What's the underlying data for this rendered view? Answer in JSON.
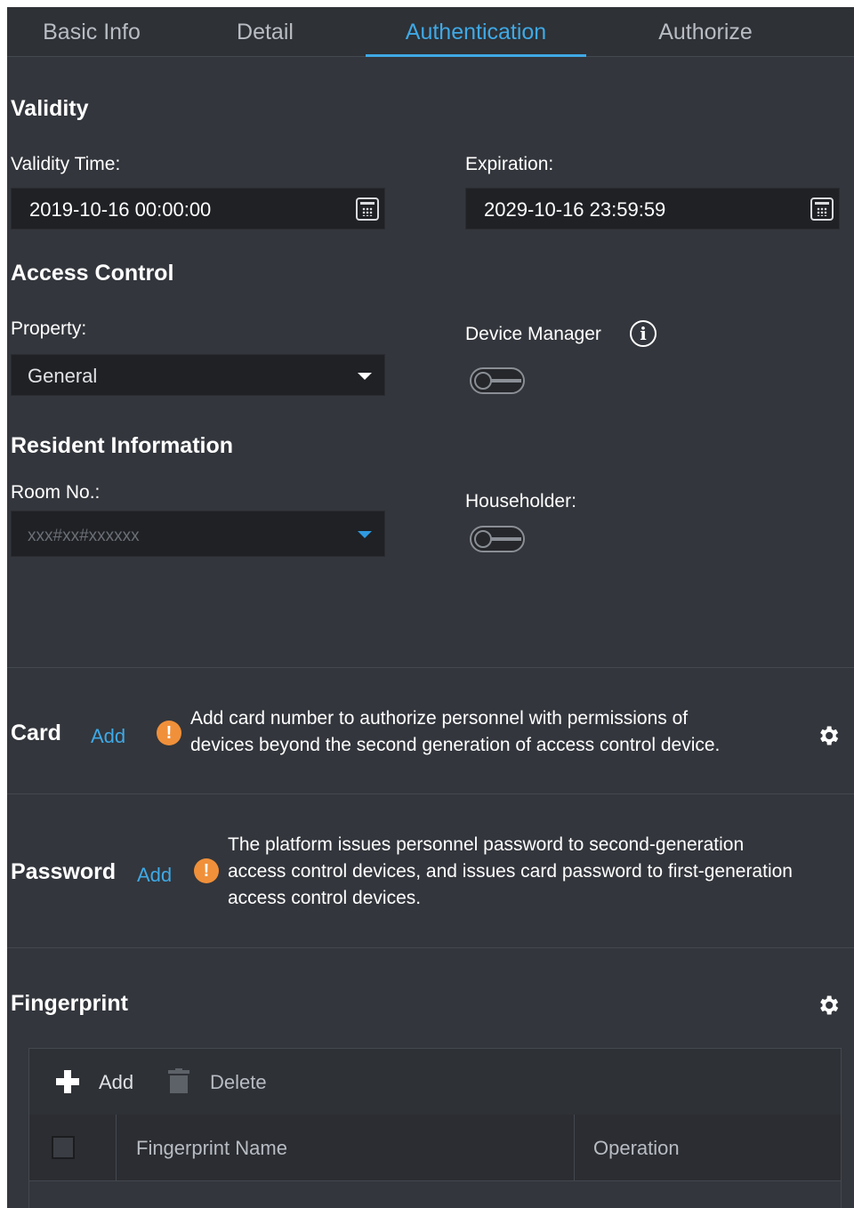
{
  "tabs": [
    {
      "label": "Basic Info",
      "active": false
    },
    {
      "label": "Detail",
      "active": false
    },
    {
      "label": "Authentication",
      "active": true
    },
    {
      "label": "Authorize",
      "active": false
    }
  ],
  "validity": {
    "title": "Validity",
    "validity_time_label": "Validity Time:",
    "validity_time_value": "2019-10-16 00:00:00",
    "expiration_label": "Expiration:",
    "expiration_value": "2029-10-16 23:59:59"
  },
  "access_control": {
    "title": "Access Control",
    "property_label": "Property:",
    "property_value": "General",
    "device_manager_label": "Device Manager",
    "device_manager_enabled": false
  },
  "resident": {
    "title": "Resident Information",
    "room_label": "Room No.:",
    "room_placeholder": "xxx#xx#xxxxxx",
    "householder_label": "Householder:",
    "householder_enabled": false
  },
  "card": {
    "title": "Card",
    "add_label": "Add",
    "hint_line1": "Add card number to authorize personnel with permissions of",
    "hint_line2": "devices beyond the second generation of access control device."
  },
  "password": {
    "title": "Password",
    "add_label": "Add",
    "hint_line1": "The platform issues personnel password to second-generation",
    "hint_line2": "access control devices, and issues card password to first-generation",
    "hint_line3": "access control devices."
  },
  "fingerprint": {
    "title": "Fingerprint",
    "add_label": "Add",
    "delete_label": "Delete",
    "columns": [
      "Fingerprint Name",
      "Operation"
    ]
  },
  "colors": {
    "accent": "#3fa9e6",
    "background": "#33363c",
    "warning": "#f0903a"
  },
  "icons": [
    "calendar-icon",
    "chevron-down-icon",
    "info-icon",
    "warning-icon",
    "gear-icon",
    "plus-icon",
    "trash-icon"
  ]
}
